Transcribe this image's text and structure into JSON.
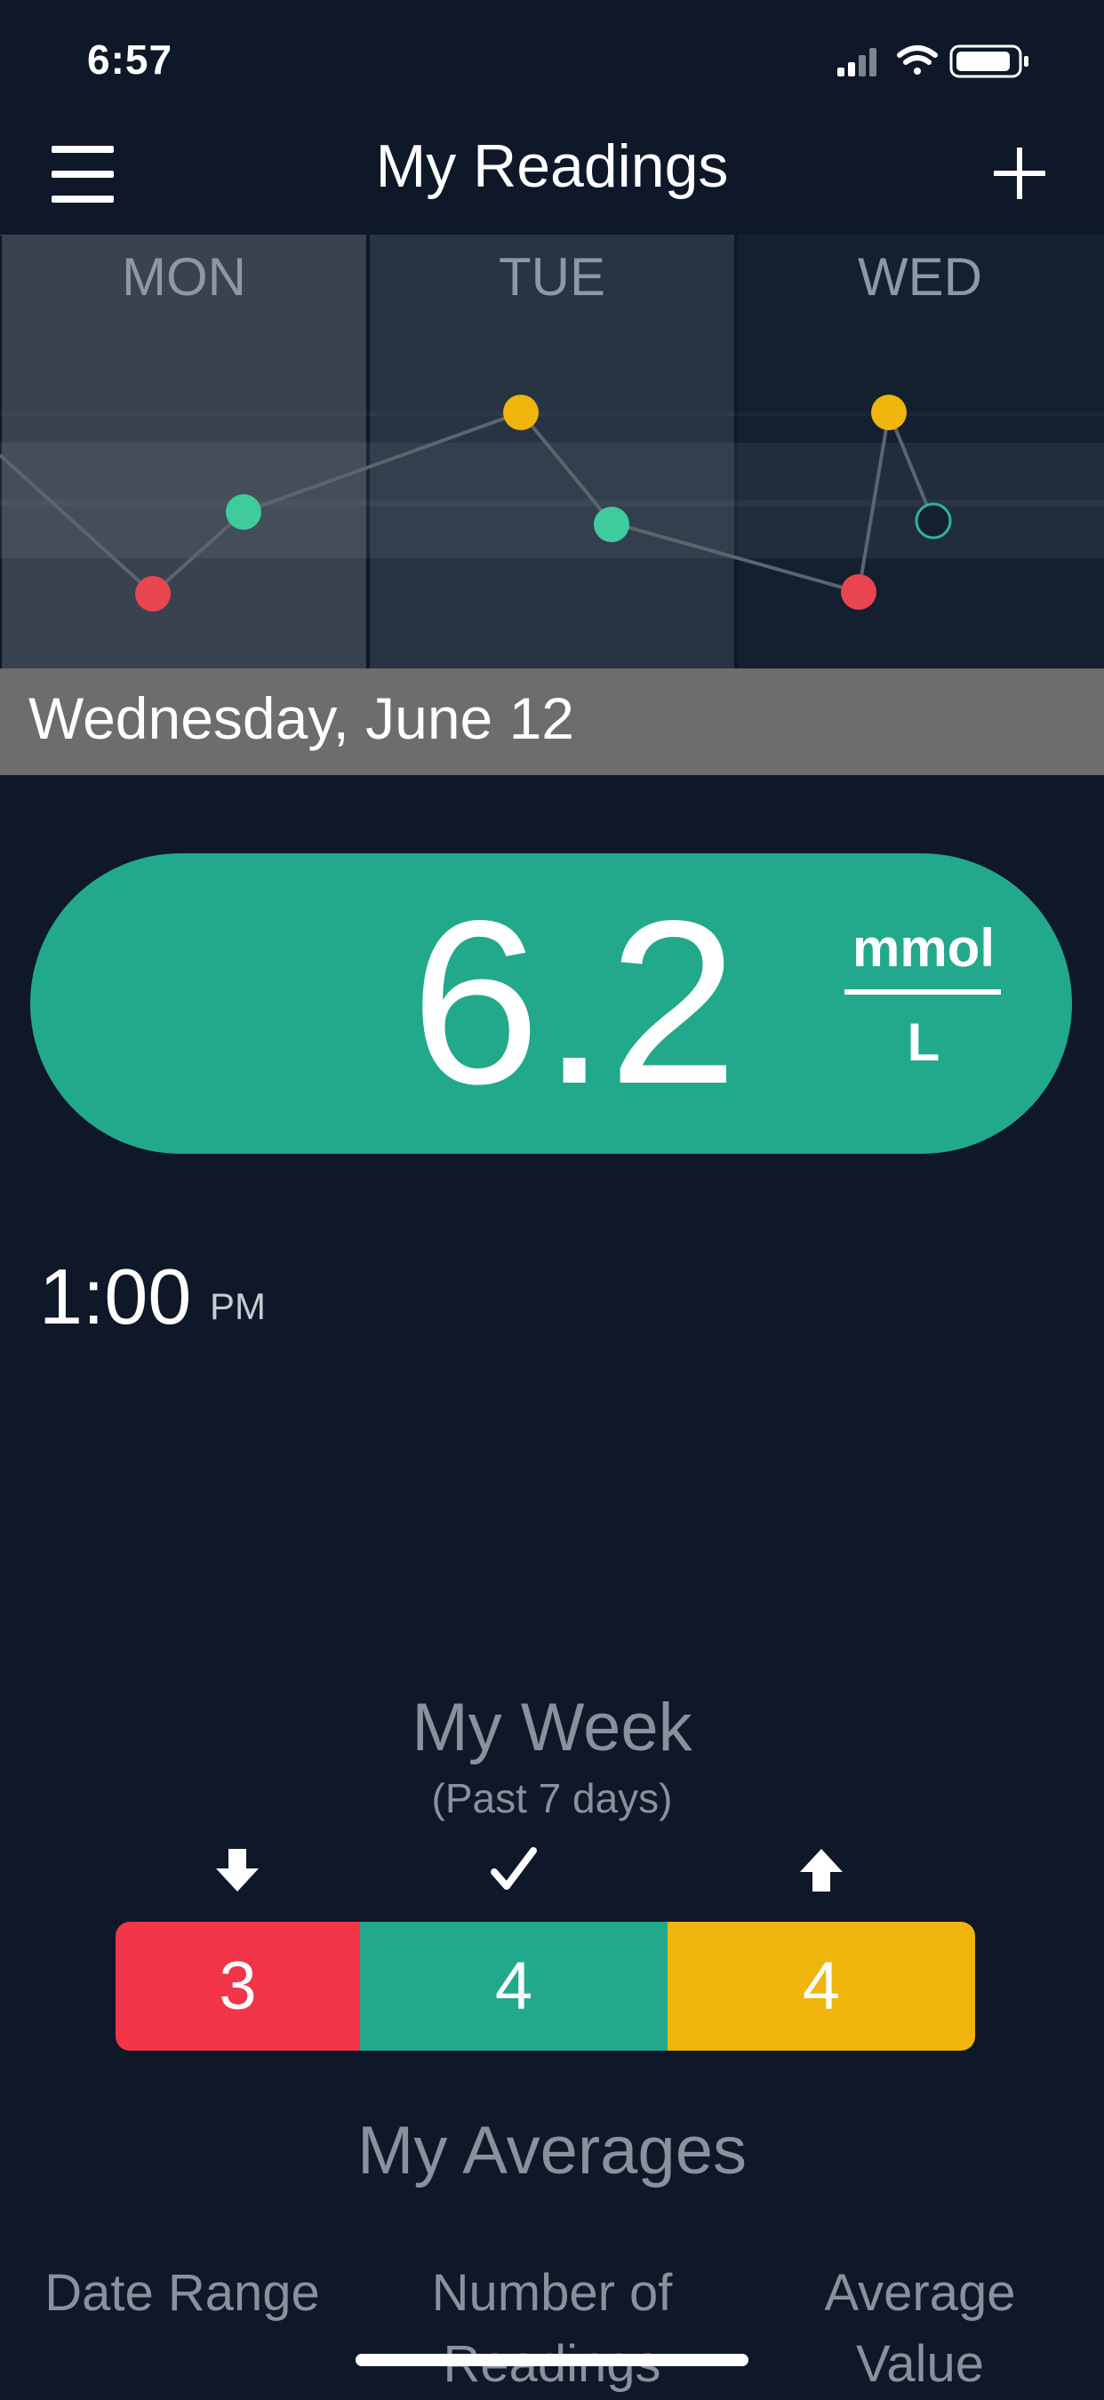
{
  "status_bar": {
    "time": "6:57"
  },
  "nav": {
    "title": "My Readings"
  },
  "chart_data": {
    "type": "line",
    "categories": [
      "MON",
      "TUE",
      "WED"
    ],
    "selected_day": "WED"
  },
  "selected_date": "Wednesday, June 12",
  "reading": {
    "value": "6.2",
    "unit_top": "mmol",
    "unit_bottom": "L",
    "time": "1:00",
    "ampm": "PM"
  },
  "my_week": {
    "title": "My Week",
    "subtitle": "(Past 7 days)",
    "low_count": "3",
    "in_range_count": "4",
    "high_count": "4"
  },
  "my_averages": {
    "title": "My Averages",
    "columns": [
      "Date Range",
      "Number of Readings",
      "Average Value"
    ]
  },
  "colors": {
    "background": "#0e1828",
    "low": "#f23549",
    "in_range": "#22a98c",
    "high": "#efb50d",
    "banner": "#6d6d6d"
  }
}
